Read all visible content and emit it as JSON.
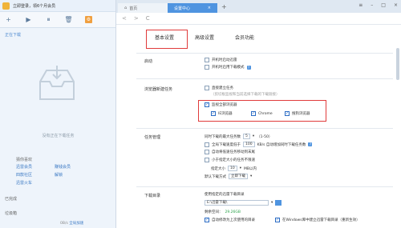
{
  "left": {
    "username": "立即登录，领6个月会员",
    "tools": [
      "+",
      "▶",
      "⏸",
      "🗑",
      "⚙"
    ],
    "tab_label": "正在下载",
    "empty_text": "没有正在下载任务",
    "rec_title": "猜你喜欢",
    "rec_links": [
      "迅雷会员",
      "赚钱会员",
      "四款社区",
      "解锁",
      "迅雷火车",
      ""
    ],
    "bottom1": "已完成",
    "bottom2": "垃圾箱",
    "status_speed": "0B/s",
    "status_link": "全局加速"
  },
  "window": {
    "tab_home": "首页",
    "tab_settings": "设置中心",
    "tab_close": "×",
    "tab_plus": "+",
    "win_controls": [
      "≡",
      "–",
      "□",
      "×"
    ],
    "nav": [
      "<",
      ">",
      "C"
    ]
  },
  "subtabs": [
    "基本设置",
    "高级设置",
    "会员功能"
  ],
  "sections": {
    "startup": {
      "label": "启动",
      "opt1": "开机时启动迅雷",
      "opt2": "开机时启用下载模式"
    },
    "browser": {
      "label": "浏览器新建任务",
      "opt1": "直接建立任务",
      "opt1_note": "（剪切板监视和当前选择下载的下载链接）",
      "opt2": "监视全部浏览器",
      "b1": "IE浏览器",
      "b2": "Chrome",
      "b3": "搜狗浏览器"
    },
    "task": {
      "label": "任务管理",
      "row1_label": "同时下载的最大任务数",
      "row1_value": "5",
      "row1_range": "（1-50）",
      "row2_label": "全局下载速度低于",
      "row2_value": "100",
      "row2_suffix": "KB/s 自动增加同时下载任务数",
      "row3": "自动将低速任务移动到末尾",
      "row4": "小于指定大小的任务不限速",
      "row5_label": "指定大小",
      "row5_value": "10",
      "row5_unit": "MB以内",
      "row6_label": "默认下载方式",
      "row6_value": "立即下载"
    },
    "dir": {
      "label": "下载目录",
      "row1": "使用指定的迅雷下载目录",
      "path": "E:\\迅雷下载\\",
      "free_label": "剩余空间：",
      "free_value": "29.26GB",
      "opt1": "自动修改为上次使用的目录",
      "opt2": "在Windows库中建立迅雷下载目录（重新生效）"
    }
  },
  "colors": {
    "accent": "#4f94e0",
    "highlight_box": "#e03b3b"
  }
}
